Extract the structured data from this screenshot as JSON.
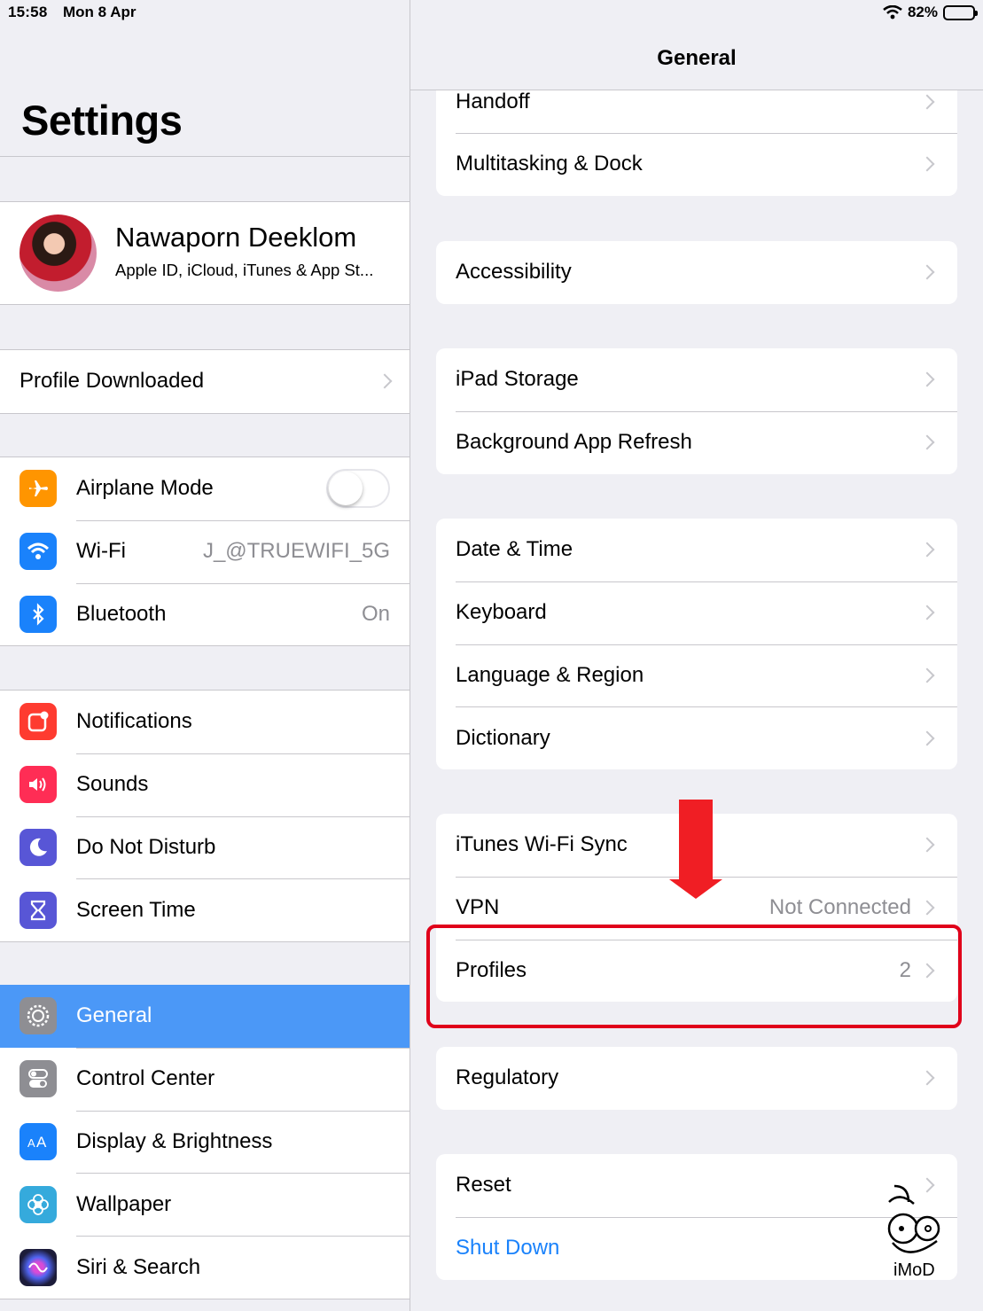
{
  "status_bar": {
    "time": "15:58",
    "date": "Mon 8 Apr",
    "battery": "82%",
    "battery_level": 0.82
  },
  "left": {
    "title": "Settings",
    "profile": {
      "name": "Nawaporn Deeklom",
      "subtitle": "Apple ID, iCloud, iTunes & App St..."
    },
    "profile_downloaded": "Profile Downloaded",
    "connectivity": [
      {
        "label": "Airplane Mode",
        "icon": "airplane-icon",
        "color": "#ff9500",
        "toggle": false
      },
      {
        "label": "Wi-Fi",
        "icon": "wifi-icon",
        "color": "#1a82fb",
        "value": "J_@TRUEWIFI_5G"
      },
      {
        "label": "Bluetooth",
        "icon": "bluetooth-icon",
        "color": "#1a82fb",
        "value": "On"
      }
    ],
    "notify": [
      {
        "label": "Notifications",
        "icon": "notifications-icon",
        "color": "#fe3b30"
      },
      {
        "label": "Sounds",
        "icon": "sounds-icon",
        "color": "#ff2d55"
      },
      {
        "label": "Do Not Disturb",
        "icon": "moon-icon",
        "color": "#5856d6"
      },
      {
        "label": "Screen Time",
        "icon": "hourglass-icon",
        "color": "#5856d6"
      }
    ],
    "system": [
      {
        "label": "General",
        "icon": "gear-icon",
        "color": "#8e8e93",
        "selected": true
      },
      {
        "label": "Control Center",
        "icon": "switches-icon",
        "color": "#8e8e93"
      },
      {
        "label": "Display & Brightness",
        "icon": "text-size-icon",
        "color": "#1a82fb"
      },
      {
        "label": "Wallpaper",
        "icon": "flower-icon",
        "color": "#35aadc"
      },
      {
        "label": "Siri & Search",
        "icon": "siri-icon",
        "color": "#1c1c3a"
      }
    ]
  },
  "right": {
    "title": "General",
    "group1": [
      {
        "label": "Handoff"
      },
      {
        "label": "Multitasking & Dock"
      }
    ],
    "group2": [
      {
        "label": "Accessibility"
      }
    ],
    "group3": [
      {
        "label": "iPad Storage"
      },
      {
        "label": "Background App Refresh"
      }
    ],
    "group4": [
      {
        "label": "Date & Time"
      },
      {
        "label": "Keyboard"
      },
      {
        "label": "Language & Region"
      },
      {
        "label": "Dictionary"
      }
    ],
    "group5": [
      {
        "label": "iTunes Wi-Fi Sync"
      },
      {
        "label": "VPN",
        "value": "Not Connected"
      },
      {
        "label": "Profiles",
        "value": "2"
      }
    ],
    "group6": [
      {
        "label": "Regulatory"
      }
    ],
    "group7": [
      {
        "label": "Reset"
      },
      {
        "label": "Shut Down"
      }
    ]
  },
  "watermark": "iMoD",
  "annotation_color": "#e0001a"
}
